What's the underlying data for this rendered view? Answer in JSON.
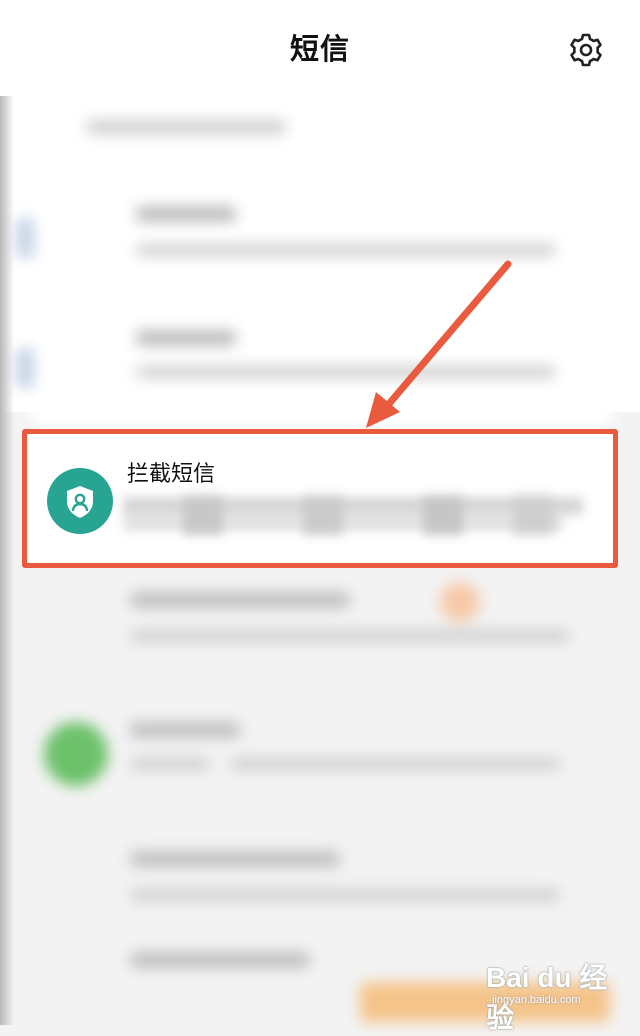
{
  "header": {
    "title": "短信",
    "settings_icon": "gear-icon"
  },
  "highlighted_item": {
    "title": "拦截短信",
    "icon": "shield-user-icon",
    "icon_color": "#27a592",
    "highlight_color": "#ea5a3e"
  },
  "annotation": {
    "arrow_color": "#ea5a3e"
  },
  "watermark": {
    "logo": "Bai du 经验",
    "url": "jingyan.baidu.com"
  }
}
